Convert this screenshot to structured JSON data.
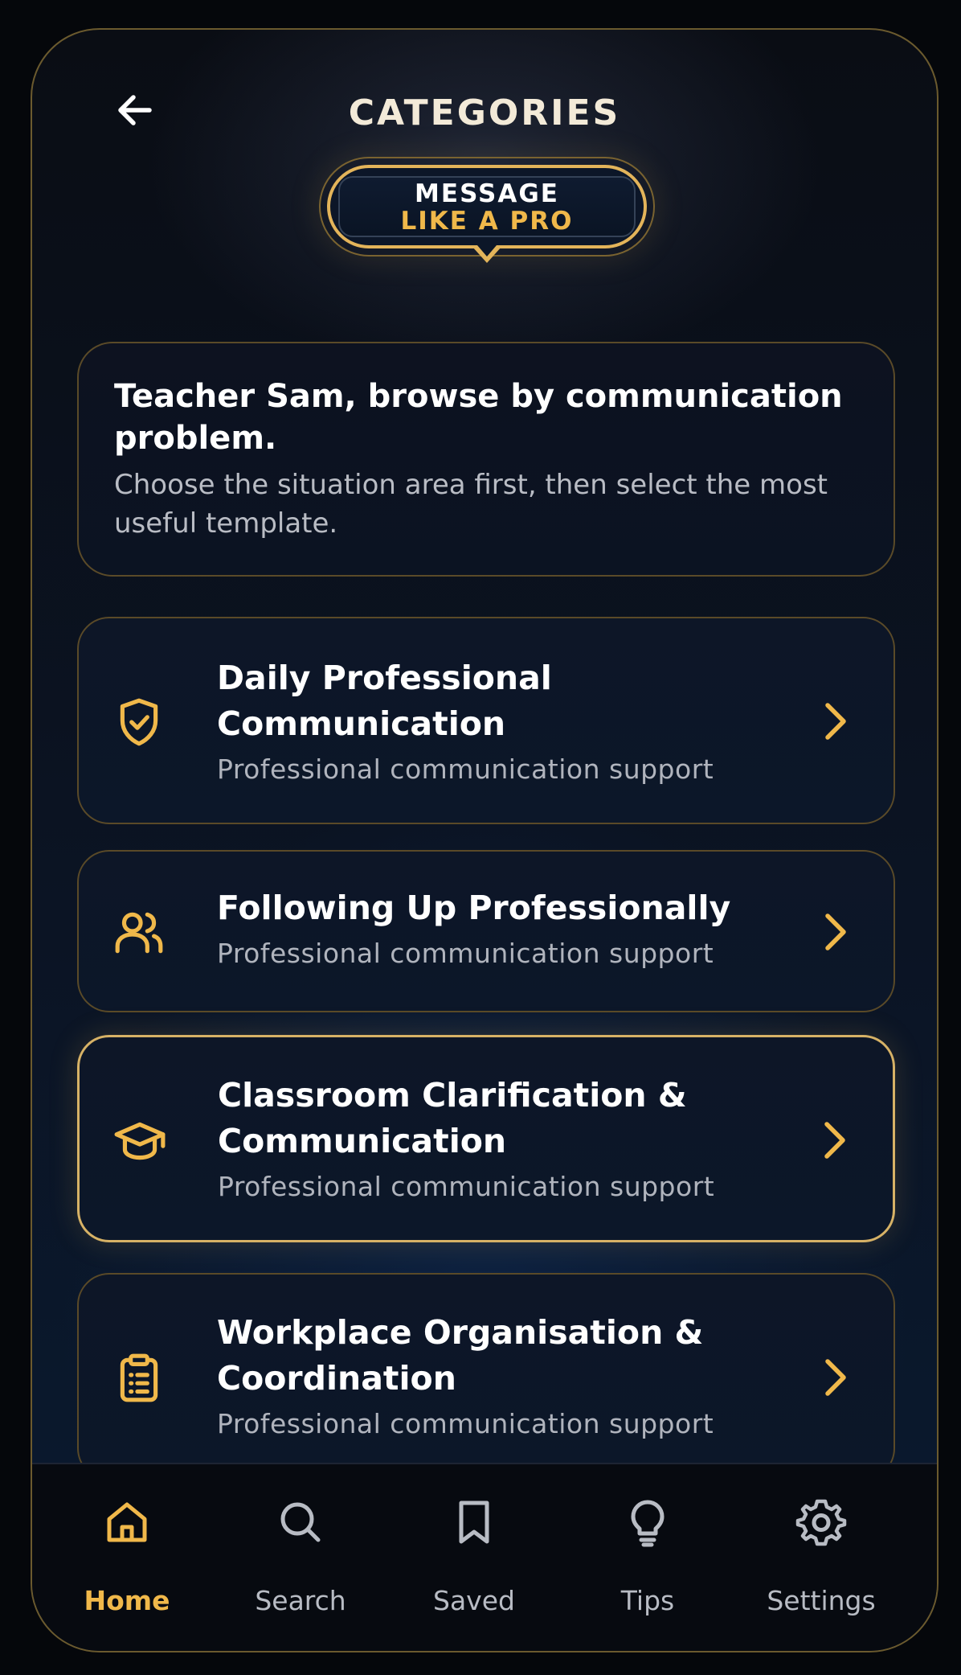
{
  "header": {
    "title": "CATEGORIES",
    "back_icon": "arrow-left-icon"
  },
  "logo": {
    "line1": "MESSAGE",
    "line2": "LIKE A PRO"
  },
  "intro": {
    "heading": "Teacher Sam, browse by communication problem.",
    "subtitle": "Choose the situation area first, then select the most useful template."
  },
  "categories": [
    {
      "title": "Daily Professional Communication",
      "subtitle": "Professional communication support",
      "icon": "shield-check-icon"
    },
    {
      "title": "Following Up Professionally",
      "subtitle": "Professional communication support",
      "icon": "users-icon"
    },
    {
      "title": "Classroom Clarification & Communication",
      "subtitle": "Professional communication support",
      "icon": "graduation-cap-icon",
      "selected": true
    },
    {
      "title": "Workplace Organisation & Coordination",
      "subtitle": "Professional communication support",
      "icon": "clipboard-list-icon"
    }
  ],
  "tabs": [
    {
      "label": "Home",
      "icon": "home-icon",
      "active": true
    },
    {
      "label": "Search",
      "icon": "search-icon"
    },
    {
      "label": "Saved",
      "icon": "bookmark-icon"
    },
    {
      "label": "Tips",
      "icon": "lightbulb-icon"
    },
    {
      "label": "Settings",
      "icon": "gear-icon"
    }
  ],
  "colors": {
    "accent": "#f0b84a",
    "border": "#5a4a28",
    "background": "#0b1424",
    "text": "#ffffff",
    "muted": "#b0b4bd"
  }
}
